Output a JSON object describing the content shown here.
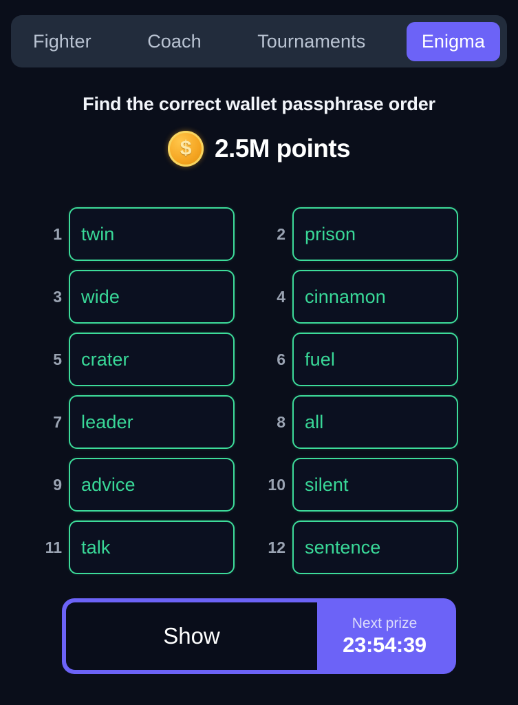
{
  "tabs": [
    {
      "label": "Fighter",
      "active": false
    },
    {
      "label": "Coach",
      "active": false
    },
    {
      "label": "Tournaments",
      "active": false
    },
    {
      "label": "Enigma",
      "active": true
    }
  ],
  "header": {
    "title": "Find the correct wallet passphrase order"
  },
  "reward": {
    "coin_icon": "gold-coin-dollar-icon",
    "coin_symbol": "$",
    "amount_text": "2.5M points"
  },
  "words": [
    {
      "number": "1",
      "word": "twin"
    },
    {
      "number": "2",
      "word": "prison"
    },
    {
      "number": "3",
      "word": "wide"
    },
    {
      "number": "4",
      "word": "cinnamon"
    },
    {
      "number": "5",
      "word": "crater"
    },
    {
      "number": "6",
      "word": "fuel"
    },
    {
      "number": "7",
      "word": "leader"
    },
    {
      "number": "8",
      "word": "all"
    },
    {
      "number": "9",
      "word": "advice"
    },
    {
      "number": "10",
      "word": "silent"
    },
    {
      "number": "11",
      "word": "talk"
    },
    {
      "number": "12",
      "word": "sentence"
    }
  ],
  "footer": {
    "show_label": "Show",
    "prize_label": "Next prize",
    "prize_timer": "23:54:39"
  },
  "colors": {
    "background": "#0a0e1a",
    "tabbar_background": "#222c3c",
    "accent_purple": "#6c63f7",
    "card_border_green": "#3ddc9a",
    "word_green": "#39d898",
    "coin_gold": "#f5a623",
    "number_grey": "#9aa3b2"
  }
}
